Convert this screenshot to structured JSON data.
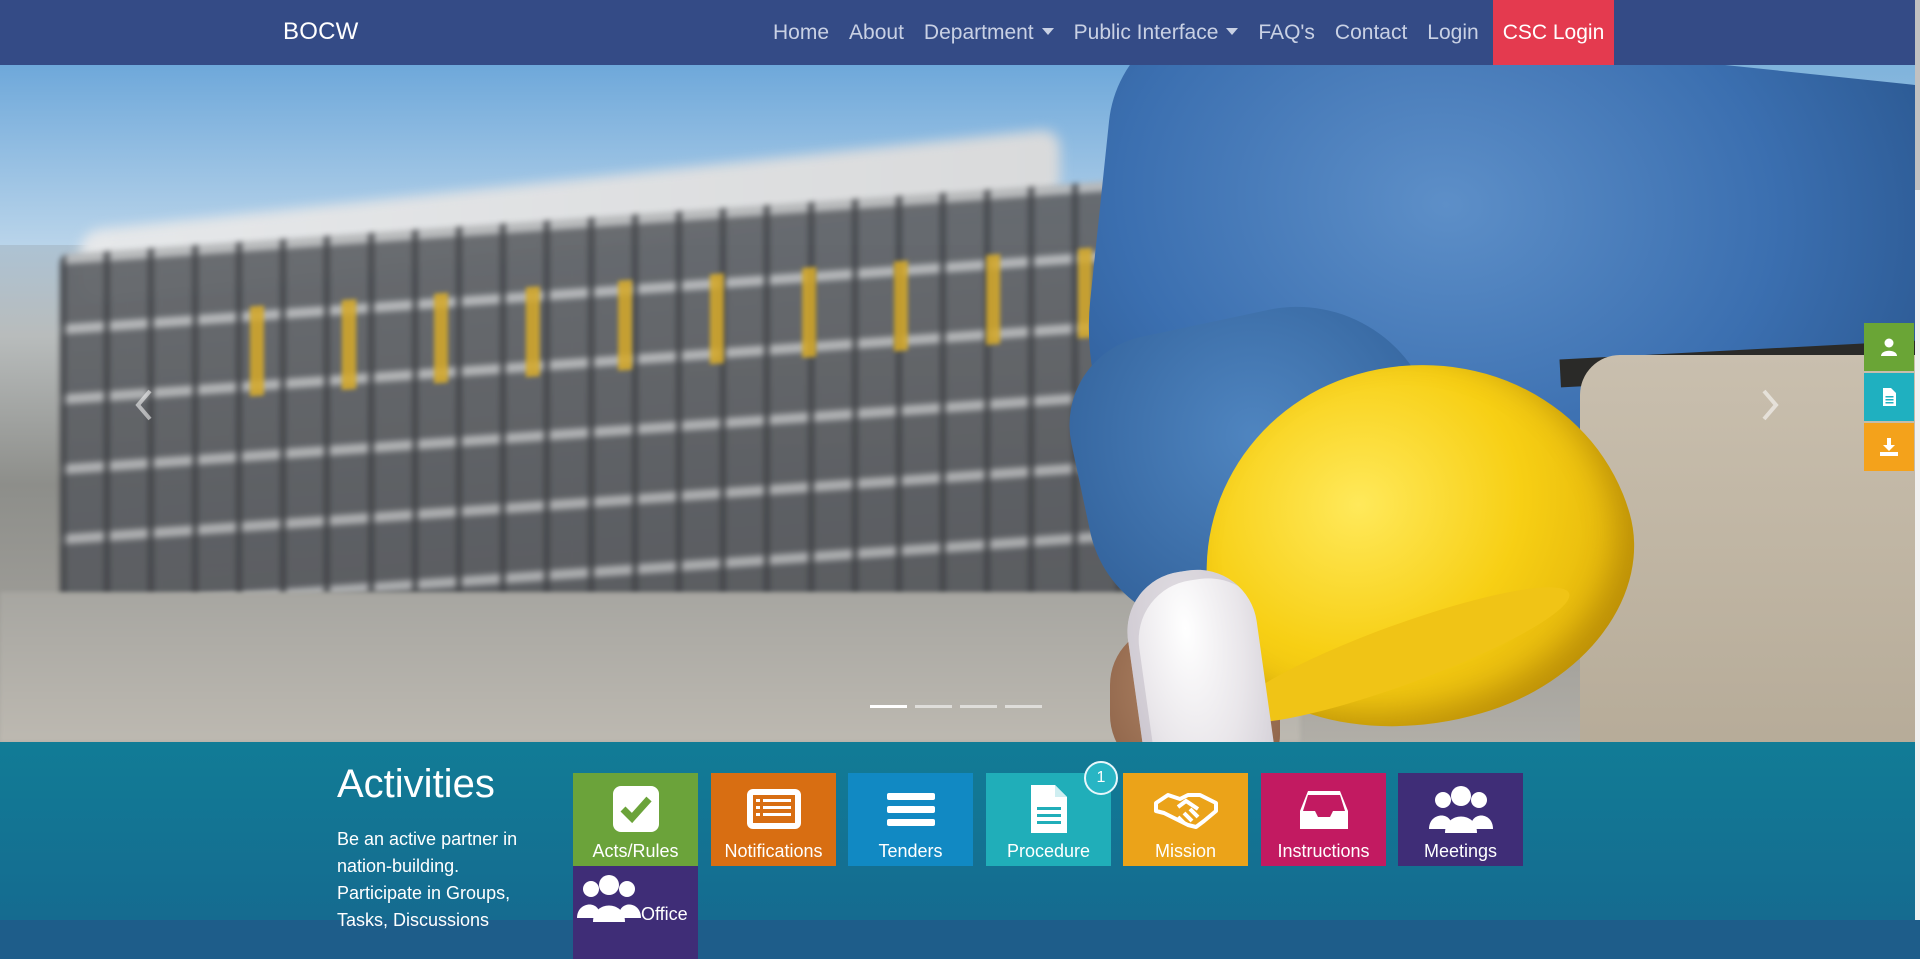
{
  "navbar": {
    "brand": "BOCW",
    "items": [
      {
        "label": "Home"
      },
      {
        "label": "About"
      },
      {
        "label": "Department",
        "dropdown": true
      },
      {
        "label": "Public Interface",
        "dropdown": true
      },
      {
        "label": "FAQ's"
      },
      {
        "label": "Contact"
      },
      {
        "label": "Login"
      },
      {
        "label": "CSC Login",
        "highlight": true
      }
    ]
  },
  "carousel": {
    "slides": 4,
    "active_index": 0
  },
  "side_tabs": [
    {
      "icon": "user-icon",
      "color": "#6aa536"
    },
    {
      "icon": "document-icon",
      "color": "#1fb0c0"
    },
    {
      "icon": "download-icon",
      "color": "#f4a21b"
    }
  ],
  "activities": {
    "title": "Activities",
    "text": "Be an active partner in nation-building. Participate in Groups, Tasks, Discussions",
    "tiles": [
      {
        "label": "Acts/Rules",
        "icon": "check-icon",
        "color": "#6ba33a"
      },
      {
        "label": "Notifications",
        "icon": "list-icon",
        "color": "#d86e12"
      },
      {
        "label": "Tenders",
        "icon": "menu-icon",
        "color": "#1189c3"
      },
      {
        "label": "Procedure",
        "icon": "document-icon",
        "color": "#20aeb9",
        "badge": "1"
      },
      {
        "label": "Mission",
        "icon": "handshake-icon",
        "color": "#eba319"
      },
      {
        "label": "Instructions",
        "icon": "inbox-icon",
        "color": "#c21a61"
      },
      {
        "label": "Meetings",
        "icon": "group-icon",
        "color": "#3f2d77"
      },
      {
        "label": "Office",
        "icon": "group-icon",
        "color": "#3f2d77"
      }
    ]
  }
}
